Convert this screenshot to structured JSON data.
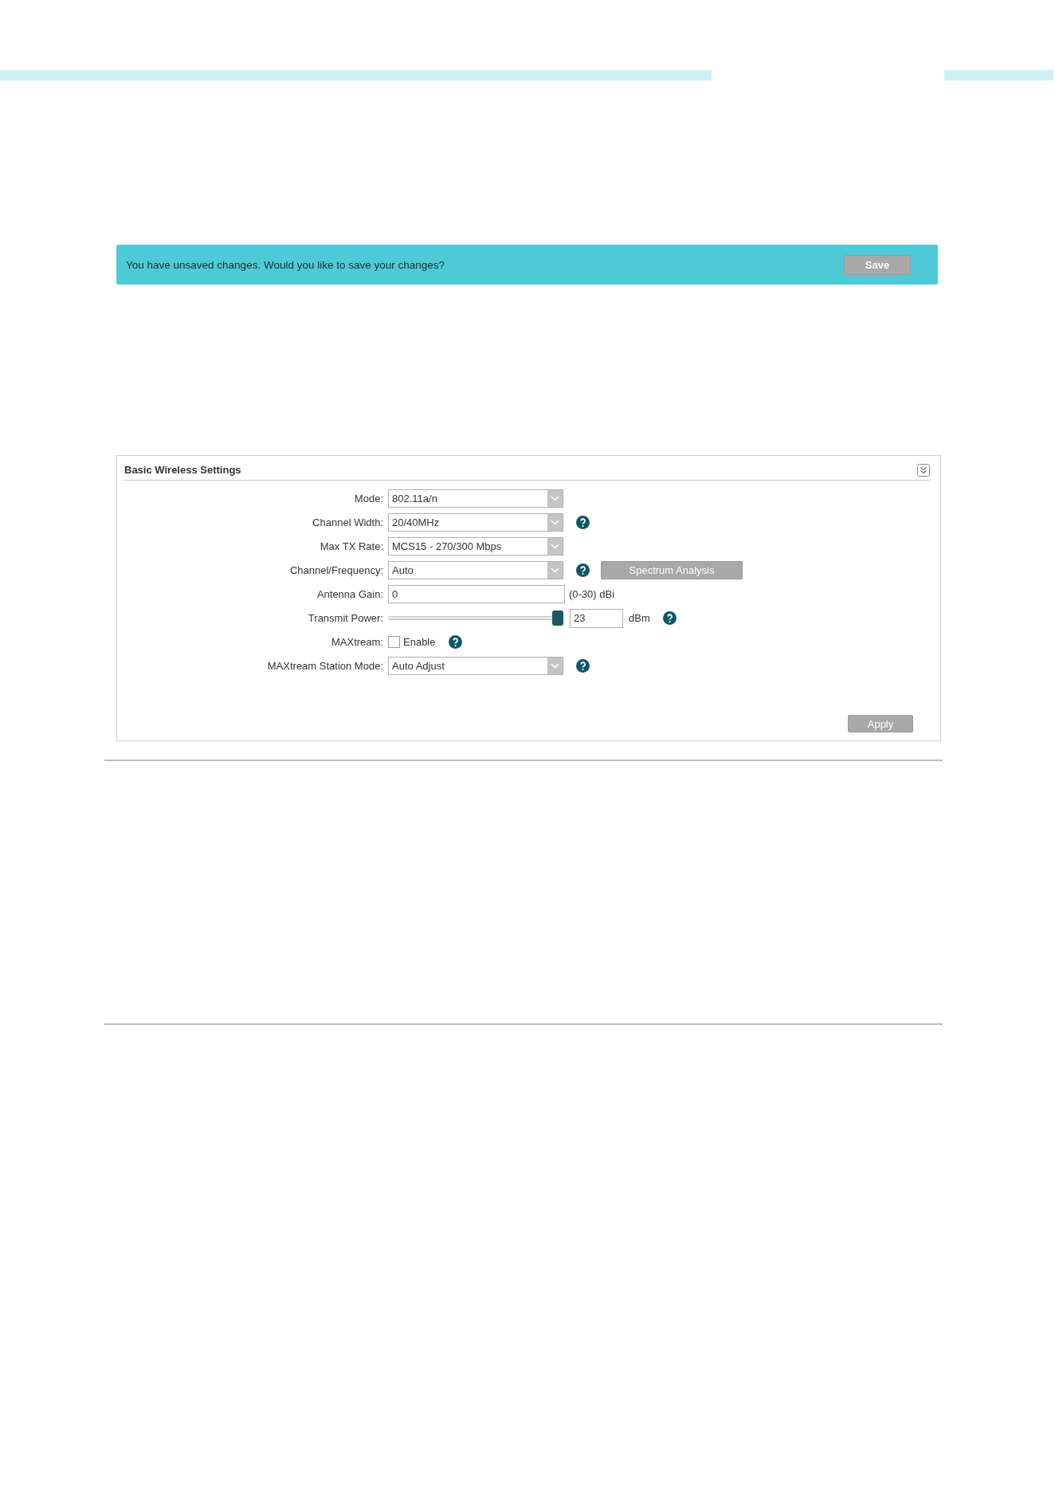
{
  "notice": {
    "message": "You have unsaved changes. Would you like to save your changes?",
    "save_button": "Save"
  },
  "panel": {
    "title": "Basic Wireless Settings",
    "fields": [
      {
        "kind": "select",
        "label": "Mode:",
        "value": "802.11a/n",
        "help": false
      },
      {
        "kind": "select",
        "label": "Channel Width:",
        "value": "20/40MHz",
        "help": true
      },
      {
        "kind": "select",
        "label": "Max TX Rate:",
        "value": "MCS15 - 270/300 Mbps",
        "help": false
      },
      {
        "kind": "select",
        "label": "Channel/Frequency:",
        "value": "Auto",
        "help": true,
        "button": "Spectrum Analysis"
      },
      {
        "kind": "input",
        "label": "Antenna Gain:",
        "value": "0",
        "unit": "(0-30) dBi",
        "help": false
      },
      {
        "kind": "slider",
        "label": "Transmit Power:",
        "level": 1,
        "value": "23",
        "unit": "dBm",
        "help": true
      },
      {
        "kind": "checkbox",
        "label": "MAXtream:",
        "option": "Enable",
        "checked": false,
        "help": true
      },
      {
        "kind": "select",
        "label": "MAXtream Station Mode:",
        "value": "Auto Adjust",
        "help": true
      }
    ],
    "apply_button": "Apply"
  }
}
